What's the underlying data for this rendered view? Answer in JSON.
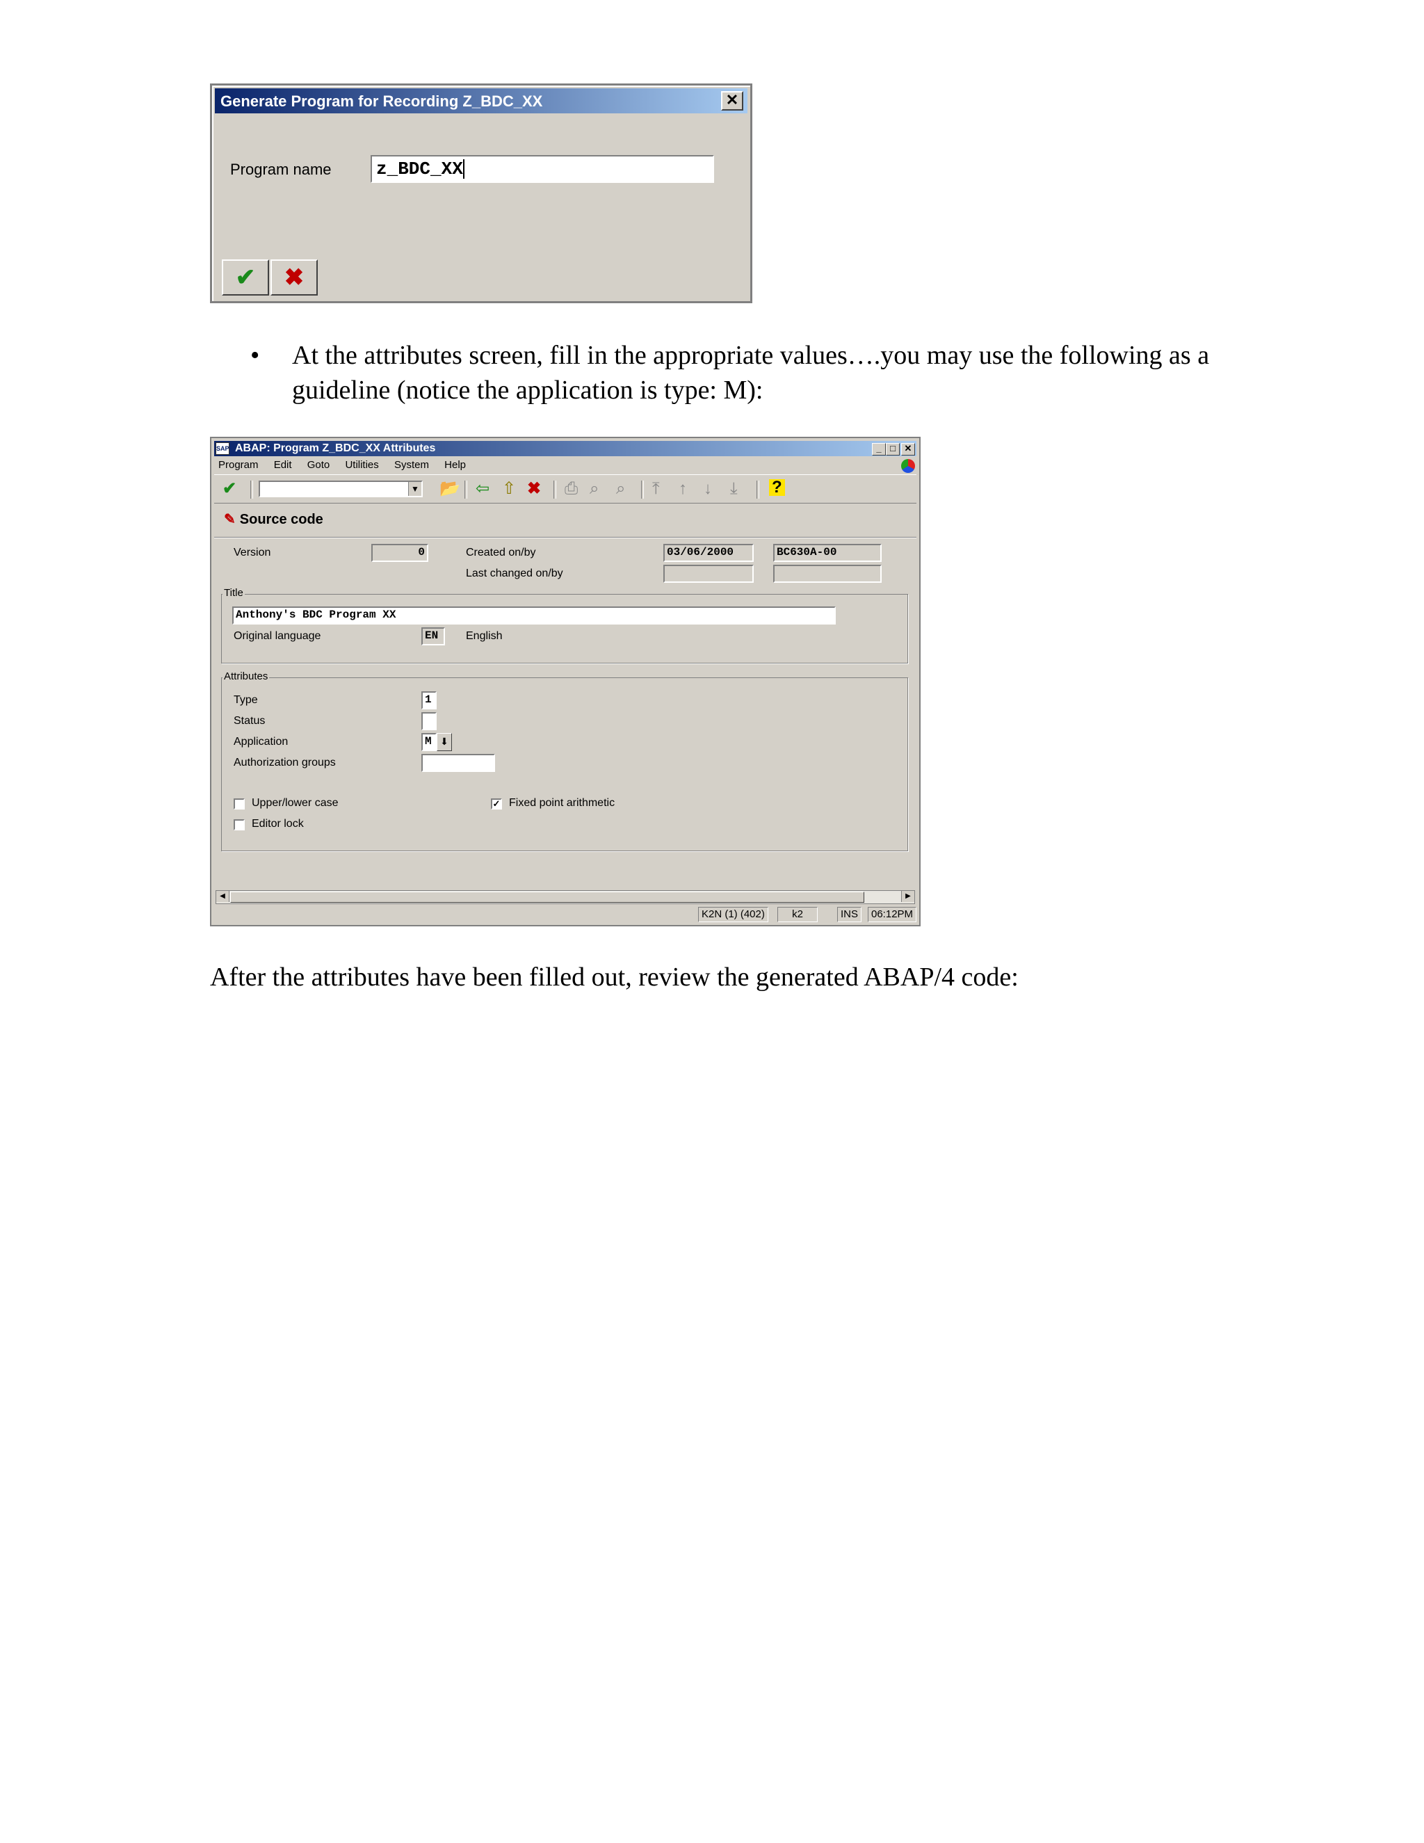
{
  "dialog": {
    "title": "Generate Program for Recording Z_BDC_XX",
    "close_glyph": "✕",
    "program_name_label": "Program name",
    "program_name_value": "z_BDC_XX",
    "ok_glyph": "✔",
    "cancel_glyph": "✖"
  },
  "bullet": {
    "marker": "•",
    "text": "At the attributes screen, fill in the appropriate values….you may use the following as a guideline (notice the application is type: M):"
  },
  "window": {
    "title": "ABAP: Program Z_BDC_XX Attributes",
    "icon_text": "SAP",
    "controls": [
      "_",
      "□",
      "✕"
    ],
    "menu": [
      "Program",
      "Edit",
      "Goto",
      "Utilities",
      "System",
      "Help"
    ],
    "toolbar": {
      "enter": "✔",
      "save": "📂",
      "back": "⇦",
      "exit": "⇧",
      "cancel": "✖",
      "print": "⎙",
      "find": "⌕",
      "find_next": "⌕",
      "first_page": "⤒",
      "prev_page": "↑",
      "next_page": "↓",
      "last_page": "⤓",
      "help": "?"
    },
    "app_toolbar_label": "Source code",
    "app_toolbar_icon": "✎",
    "version_label": "Version",
    "version_value": "0",
    "created_label": "Created on/by",
    "created_date": "03/06/2000",
    "created_by": "BC630A-00",
    "last_changed_label": "Last changed on/by",
    "title_group": "Title",
    "title_value": "Anthony's BDC Program XX",
    "orig_lang_label": "Original language",
    "orig_lang_code": "EN",
    "orig_lang_name": "English",
    "attributes_group": "Attributes",
    "type_label": "Type",
    "type_value": "1",
    "status_label": "Status",
    "status_value": "",
    "application_label": "Application",
    "application_value": "M",
    "auth_groups_label": "Authorization groups",
    "upper_lower_label": "Upper/lower case",
    "upper_lower_checked": false,
    "fixed_point_label": "Fixed point arithmetic",
    "fixed_point_checked": true,
    "editor_lock_label": "Editor lock",
    "editor_lock_checked": false,
    "status_system": "K2N (1) (402)",
    "status_server": "k2",
    "status_mode": "INS",
    "status_time": "06:12PM"
  },
  "closing_text": "After the attributes have been filled out, review the generated ABAP/4 code:"
}
